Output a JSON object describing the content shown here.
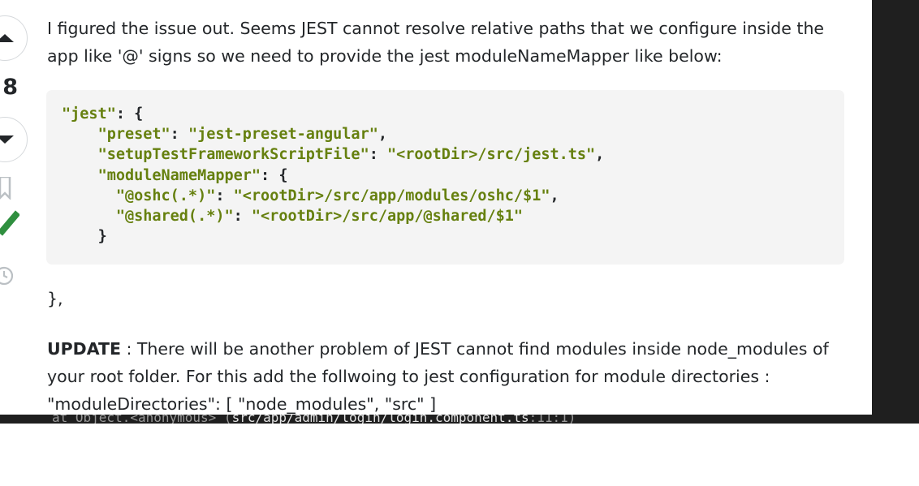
{
  "vote": {
    "count": "8"
  },
  "answer": {
    "intro": "I figured the issue out. Seems JEST cannot resolve relative paths that we configure inside the app like '@' signs so we need to provide the jest moduleNameMapper like below:",
    "code": {
      "line1_key": "\"jest\"",
      "line1_rest": ": {",
      "line2_key": "\"preset\"",
      "line2_sep": ": ",
      "line2_val": "\"jest-preset-angular\"",
      "line2_end": ",",
      "line3_key": "\"setupTestFrameworkScriptFile\"",
      "line3_sep": ": ",
      "line3_val": "\"<rootDir>/src/jest.ts\"",
      "line3_end": ",",
      "line4_key": "\"moduleNameMapper\"",
      "line4_rest": ": {",
      "line5_key": "\"@oshc(.*)\"",
      "line5_sep": ": ",
      "line5_val": "\"<rootDir>/src/app/modules/oshc/$1\"",
      "line5_end": ",",
      "line6_key": "\"@shared(.*)\"",
      "line6_sep": ": ",
      "line6_val": "\"<rootDir>/src/app/@shared/$1\"",
      "line7": "}"
    },
    "closing": "},",
    "update_label": "UPDATE",
    "update_text": " : There will be another problem of JEST cannot find modules inside node_modules of your root folder. For this add the follwoing to jest configuration for module directories : \"moduleDirectories\": [ \"node_modules\", \"src\" ]"
  },
  "terminal": {
    "prefix": "at Object.<anonymous> (",
    "path": "src/app/admin/login/login.component.ts",
    "suffix": ":11:1)"
  },
  "colors": {
    "string": "#66800f",
    "text": "#232629",
    "accepted": "#2f8f3f"
  }
}
